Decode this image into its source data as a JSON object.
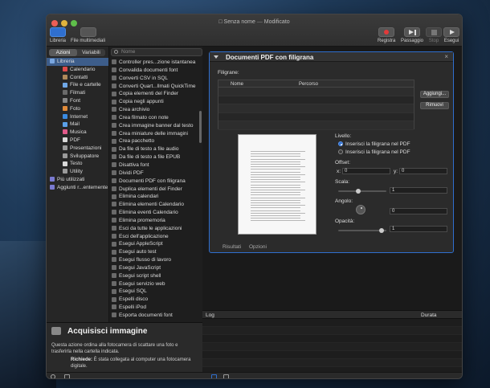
{
  "window": {
    "title": "Senza nome",
    "subtitle": "Modificato"
  },
  "toolbar": {
    "library_label": "Libreria",
    "media_label": "File multimediali",
    "record_label": "Registra",
    "step_label": "Passaggio",
    "stop_label": "Stop",
    "run_label": "Esegui"
  },
  "library": {
    "tab_actions": "Azioni",
    "tab_variables": "Variabili",
    "items": [
      {
        "label": "Libreria",
        "color": "#7aa7e0"
      },
      {
        "label": "Calendario",
        "color": "#e04b4b"
      },
      {
        "label": "Contatti",
        "color": "#b08a5a"
      },
      {
        "label": "File e cartelle",
        "color": "#6fa8e8"
      },
      {
        "label": "Filmati",
        "color": "#6a6a6a"
      },
      {
        "label": "Font",
        "color": "#888888"
      },
      {
        "label": "Foto",
        "color": "#e08a3a"
      },
      {
        "label": "Internet",
        "color": "#3a8ae0"
      },
      {
        "label": "Mail",
        "color": "#5aa0e8"
      },
      {
        "label": "Musica",
        "color": "#e05a8a"
      },
      {
        "label": "PDF",
        "color": "#d9d9d9"
      },
      {
        "label": "Presentazioni",
        "color": "#9a9a9a"
      },
      {
        "label": "Sviluppatore",
        "color": "#9a9a9a"
      },
      {
        "label": "Testo",
        "color": "#d9d9d9"
      },
      {
        "label": "Utility",
        "color": "#9a9a9a"
      },
      {
        "label": "Più utilizzati",
        "color": "#7a7ad0"
      },
      {
        "label": "Aggiunti r...entemente",
        "color": "#7a7ad0"
      }
    ]
  },
  "search": {
    "placeholder": "Nome"
  },
  "actions": [
    "Controller pres...zione istantanea",
    "Convalida documenti font",
    "Converti CSV in SQL",
    "Converti Quart...llmati QuickTime",
    "Copia elementi del Finder",
    "Copia negli appunti",
    "Crea archivio",
    "Crea filmato con note",
    "Crea immagine banner dal testo",
    "Crea miniature delle immagini",
    "Crea pacchetto",
    "Da file di testo a file audio",
    "Da file di testo a file EPUB",
    "Disattiva font",
    "Dividi PDF",
    "Documenti PDF con filigrana",
    "Duplica elementi del Finder",
    "Elimina calendari",
    "Elimina elementi Calendario",
    "Elimina eventi Calendario",
    "Elimina promemoria",
    "Esci da tutte le applicazioni",
    "Esci dell'applicazione",
    "Esegui AppleScript",
    "Esegui auto test",
    "Esegui flusso di lavoro",
    "Esegui JavaScript",
    "Esegui script shell",
    "Esegui servizio web",
    "Esegui SQL",
    "Espelli disco",
    "Espelli iPod",
    "Esporta documenti font"
  ],
  "description": {
    "title": "Acquisisci immagine",
    "body": "Questa azione ordina alla fotocamera di scattare una foto e trasferirla nella cartella indicata.",
    "req_label": "Richiede:",
    "req_text": "È stata collegata al computer una fotocamera digitale."
  },
  "card": {
    "title": "Documenti PDF con filigrana",
    "watermarks_label": "Filigrane:",
    "col_name": "Nome",
    "col_path": "Percorso",
    "add_button": "Aggiungi...",
    "remove_button": "Rimuovi",
    "level_label": "Livello:",
    "level_over": "Inserisci la filigrana nel PDF",
    "level_under": "Inserisci la filigrana nel PDF",
    "offset_label": "Offset:",
    "x_label": "x:",
    "x_value": "0",
    "y_label": "y:",
    "y_value": "0",
    "scale_label": "Scala:",
    "scale_value": "1",
    "scale_level": 0.4,
    "angle_label": "Angolo:",
    "angle_value": "0",
    "opacity_label": "Opacità:",
    "opacity_value": "1",
    "opacity_level": 0.95,
    "tab_results": "Risultati",
    "tab_options": "Opzioni"
  },
  "log": {
    "col_log": "Log",
    "col_duration": "Durata"
  },
  "colors": {
    "accent": "#2f6fcf",
    "close": "#ec5f57",
    "minimize": "#e0b33d",
    "maximize": "#5fbf4a"
  }
}
